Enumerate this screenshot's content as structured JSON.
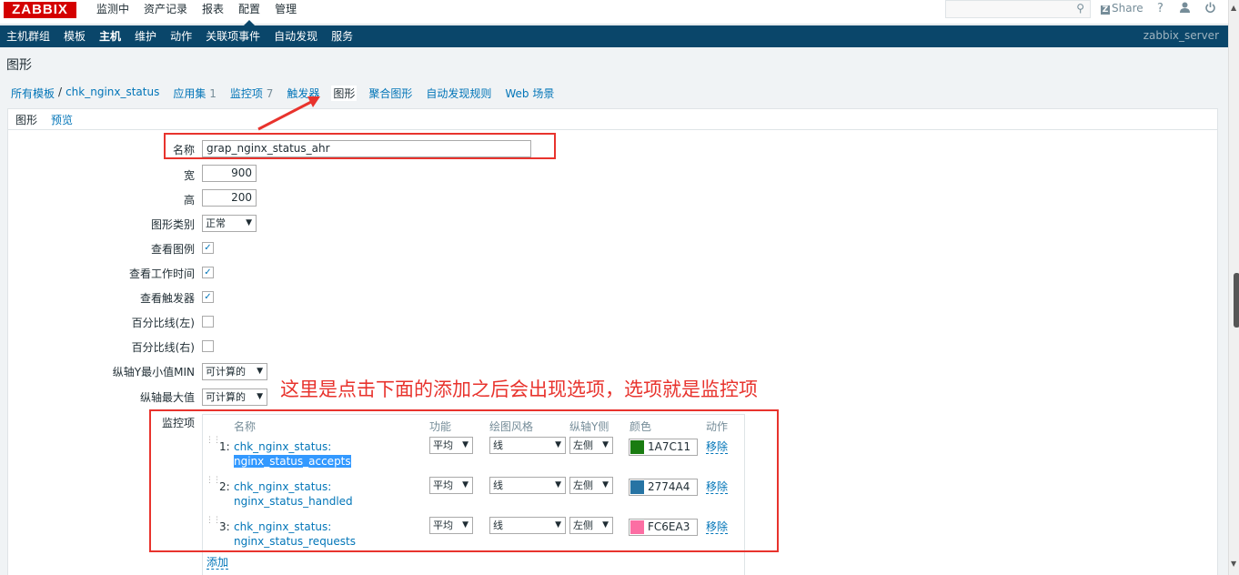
{
  "topbar": {
    "logo": "ZABBIX",
    "menu": [
      "监测中",
      "资产记录",
      "报表",
      "配置",
      "管理"
    ],
    "share": "Share",
    "share_icon": "Z",
    "help": "?",
    "user_icon": "user-icon",
    "logout_icon": "power-icon"
  },
  "submenu": {
    "items": [
      "主机群组",
      "模板",
      "主机",
      "维护",
      "动作",
      "关联项事件",
      "自动发现",
      "服务"
    ],
    "server": "zabbix_server"
  },
  "page_title": "图形",
  "breadcrumb": {
    "all_templates": "所有模板",
    "sep": "/",
    "template": "chk_nginx_status",
    "apps": "应用集",
    "apps_count": "1",
    "items": "监控项",
    "items_count": "7",
    "triggers": "触发器",
    "graphs": "图形",
    "screens": "聚合图形",
    "discovery": "自动发现规则",
    "web": "Web 场景"
  },
  "tabs": [
    "图形",
    "预览"
  ],
  "form": {
    "name_label": "名称",
    "name_value": "grap_nginx_status_ahr",
    "width_label": "宽",
    "width_value": "900",
    "height_label": "高",
    "height_value": "200",
    "graph_type_label": "图形类别",
    "graph_type_value": "正常",
    "show_legend_label": "查看图例",
    "show_working_time_label": "查看工作时间",
    "show_triggers_label": "查看触发器",
    "percentile_left_label": "百分比线(左)",
    "percentile_right_label": "百分比线(右)",
    "ymin_label": "纵轴Y最小值MIN",
    "ymin_value": "可计算的",
    "ymax_label": "纵轴最大值",
    "ymax_value": "可计算的",
    "items_label": "监控项"
  },
  "items_table": {
    "headers": [
      "名称",
      "功能",
      "绘图风格",
      "纵轴Y侧",
      "颜色",
      "动作"
    ],
    "rows": [
      {
        "num": "1:",
        "host": "chk_nginx_status:",
        "key": "nginx_status_accepts",
        "func": "平均",
        "style": "线",
        "side": "左侧",
        "color": "1A7C11",
        "color_hex": "#1A7C11",
        "action": "移除"
      },
      {
        "num": "2:",
        "host": "chk_nginx_status:",
        "key": "nginx_status_handled",
        "func": "平均",
        "style": "线",
        "side": "左侧",
        "color": "2774A4",
        "color_hex": "#2774A4",
        "action": "移除"
      },
      {
        "num": "3:",
        "host": "chk_nginx_status:",
        "key": "nginx_status_requests",
        "func": "平均",
        "style": "线",
        "side": "左侧",
        "color": "FC6EA3",
        "color_hex": "#FC6EA3",
        "action": "移除"
      }
    ],
    "add": "添加"
  },
  "annotation": "这里是点击下面的添加之后会出现选项，选项就是监控项"
}
